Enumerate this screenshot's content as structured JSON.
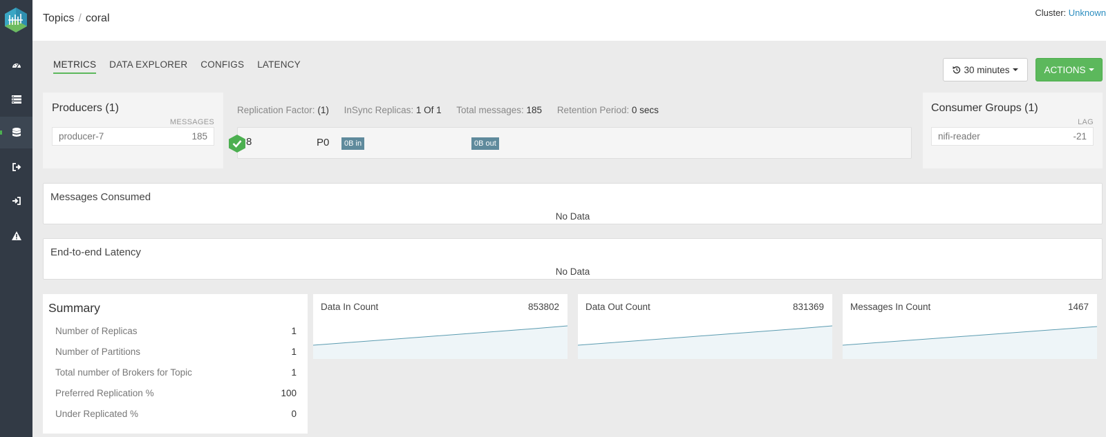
{
  "breadcrumb": {
    "root": "Topics",
    "separator": "/",
    "current": "coral"
  },
  "cluster": {
    "label": "Cluster:",
    "value": "Unknown"
  },
  "sidebar": {
    "icons": [
      "dashboard-icon",
      "brokers-list-icon",
      "topics-database-icon",
      "producers-icon",
      "consumers-icon",
      "alerts-icon"
    ],
    "active": "topics-database-icon"
  },
  "tabs": [
    {
      "label": "METRICS",
      "active": true
    },
    {
      "label": "DATA EXPLORER",
      "active": false
    },
    {
      "label": "CONFIGS",
      "active": false
    },
    {
      "label": "LATENCY",
      "active": false
    }
  ],
  "time_range": {
    "label": "30 minutes",
    "icon": "history-icon"
  },
  "actions": {
    "label": "ACTIONS"
  },
  "producers": {
    "title": "Producers (1)",
    "column": "MESSAGES",
    "items": [
      {
        "name": "producer-7",
        "value": "185"
      }
    ]
  },
  "topic_meta": {
    "replication_label": "Replication Factor:",
    "replication_value": "(1)",
    "insync_label": "InSync Replicas:",
    "insync_value": "1 Of 1",
    "total_label": "Total messages:",
    "total_value": "185",
    "retention_label": "Retention Period:",
    "retention_value": "0 secs"
  },
  "partition": {
    "leader": "8",
    "name": "P0",
    "in_badge": "0B in",
    "out_badge": "0B out"
  },
  "consumers": {
    "title": "Consumer Groups (1)",
    "column": "LAG",
    "items": [
      {
        "name": "nifi-reader",
        "value": "-21"
      }
    ]
  },
  "messages_consumed": {
    "title": "Messages Consumed",
    "empty": "No Data"
  },
  "latency": {
    "title": "End-to-end Latency",
    "empty": "No Data"
  },
  "summary": {
    "title": "Summary",
    "rows": [
      {
        "label": "Number of Replicas",
        "value": "1"
      },
      {
        "label": "Number of Partitions",
        "value": "1"
      },
      {
        "label": "Total number of Brokers for Topic",
        "value": "1"
      },
      {
        "label": "Preferred Replication %",
        "value": "100"
      },
      {
        "label": "Under Replicated %",
        "value": "0"
      }
    ]
  },
  "sparklines": [
    {
      "label": "Data In Count",
      "value": "853802"
    },
    {
      "label": "Data Out Count",
      "value": "831369"
    },
    {
      "label": "Messages In Count",
      "value": "1467"
    }
  ],
  "colors": {
    "accent_green": "#5cb85c",
    "link_blue": "#2d8ec0",
    "sidebar_bg": "#323a45",
    "badge_bg": "#5f8a9c",
    "spark_line": "#5a9bb0"
  }
}
